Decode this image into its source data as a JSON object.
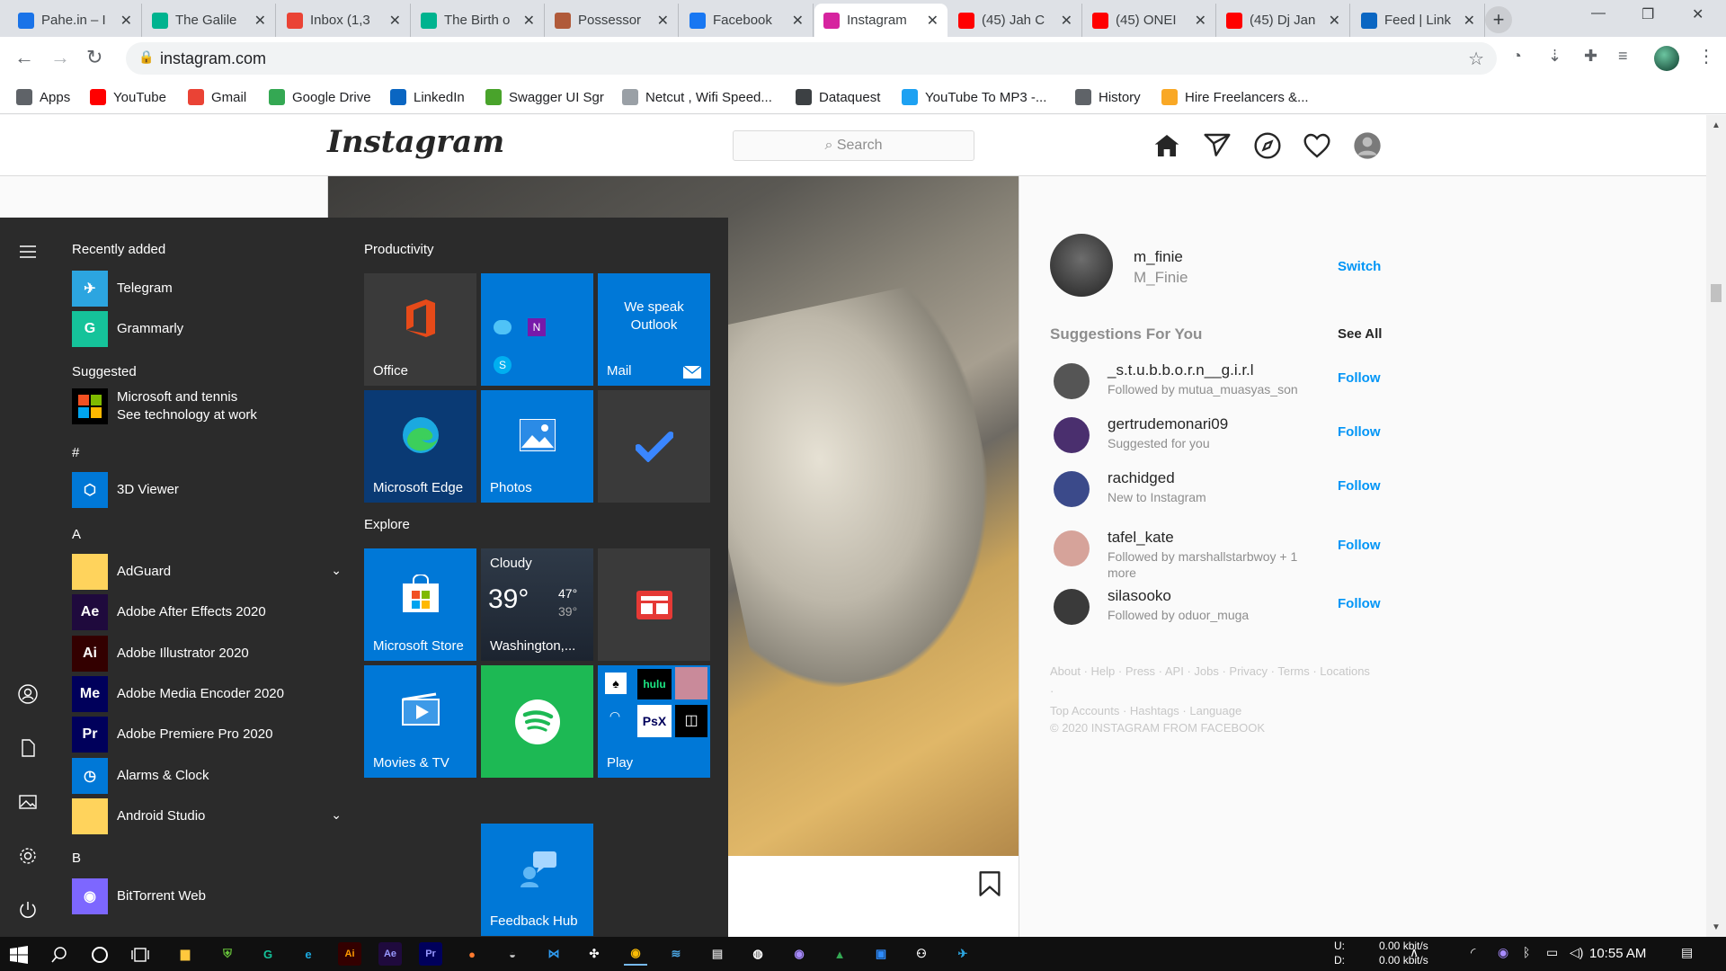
{
  "browser": {
    "tabs": [
      {
        "title": "Pahe.in – I",
        "fav": "pahe",
        "color": "#1a73e8"
      },
      {
        "title": "The Galile",
        "fav": "T",
        "color": "#00b38f"
      },
      {
        "title": "Inbox (1,3",
        "fav": "M",
        "color": "#ea4335"
      },
      {
        "title": "The Birth o",
        "fav": "T",
        "color": "#00b38f"
      },
      {
        "title": "Possessor",
        "fav": "P",
        "color": "#b05a3a"
      },
      {
        "title": "Facebook",
        "fav": "f",
        "color": "#1877f2"
      },
      {
        "title": "Instagram",
        "fav": "ig",
        "color": "#d6249f"
      },
      {
        "title": "(45) Jah C",
        "fav": "yt",
        "color": "#ff0000"
      },
      {
        "title": "(45) ONEI",
        "fav": "yt",
        "color": "#ff0000"
      },
      {
        "title": "(45) Dj Jan",
        "fav": "yt",
        "color": "#ff0000"
      },
      {
        "title": "Feed | Link",
        "fav": "in",
        "color": "#0a66c2"
      }
    ],
    "url": "instagram.com",
    "bookmarks": [
      {
        "label": "Apps",
        "icon": "apps-grid-icon",
        "color": "#5f6368"
      },
      {
        "label": "YouTube",
        "icon": "youtube-icon",
        "color": "#ff0000"
      },
      {
        "label": "Gmail",
        "icon": "gmail-icon",
        "color": "#ea4335"
      },
      {
        "label": "Google Drive",
        "icon": "drive-icon",
        "color": "#34a853"
      },
      {
        "label": "LinkedIn",
        "icon": "linkedin-icon",
        "color": "#0a66c2"
      },
      {
        "label": "Swagger UI Sgr",
        "icon": "swagger-icon",
        "color": "#49a32b"
      },
      {
        "label": "Netcut , Wifi Speed...",
        "icon": "netcut-icon",
        "color": "#9aa0a6"
      },
      {
        "label": "Dataquest",
        "icon": "dataquest-icon",
        "color": "#3c4043"
      },
      {
        "label": "YouTube To MP3 -...",
        "icon": "download-icon",
        "color": "#1da1f2"
      },
      {
        "label": "History",
        "icon": "history-icon",
        "color": "#5f6368"
      },
      {
        "label": "Hire Freelancers &...",
        "icon": "freelancer-icon",
        "color": "#f9a825"
      }
    ]
  },
  "instagram": {
    "logo": "Instagram",
    "search_placeholder": "Search",
    "me": {
      "username": "m_finie",
      "name": "M_Finie",
      "switch_label": "Switch"
    },
    "suggestions_title": "Suggestions For You",
    "see_all": "See All",
    "suggestions": [
      {
        "username": "_s.t.u.b.b.o.r.n__g.i.r.l",
        "sub": "Followed by mutua_muasyas_son",
        "action": "Follow",
        "avatar_color": "#555555"
      },
      {
        "username": "gertrudemonari09",
        "sub": "Suggested for you",
        "action": "Follow",
        "avatar_color": "#4a2f6e"
      },
      {
        "username": "rachidged",
        "sub": "New to Instagram",
        "action": "Follow",
        "avatar_color": "#3b4a8a"
      },
      {
        "username": "tafel_kate",
        "sub": "Followed by marshallstarbwoy + 1 more",
        "action": "Follow",
        "avatar_color": "#d6a39a"
      },
      {
        "username": "silasooko",
        "sub": "Followed by oduor_muga",
        "action": "Follow",
        "avatar_color": "#3a3a3a"
      }
    ],
    "footer_line1": "About · Help · Press · API · Jobs · Privacy · Terms · Locations ·",
    "footer_line2": "Top Accounts · Hashtags · Language",
    "copyright": "© 2020 INSTAGRAM FROM FACEBOOK"
  },
  "start_menu": {
    "recently_added_label": "Recently added",
    "recent": [
      {
        "name": "Telegram",
        "letter": "✈",
        "color": "#2ca5e0"
      },
      {
        "name": "Grammarly",
        "letter": "G",
        "color": "#15c39a"
      }
    ],
    "suggested_label": "Suggested",
    "suggested": {
      "line1": "Microsoft and tennis",
      "line2": "See technology at work"
    },
    "hash_label": "#",
    "viewer": {
      "name": "3D Viewer",
      "letter": "⬡",
      "color": "#0078d7"
    },
    "a_label": "A",
    "a_apps": [
      {
        "name": "AdGuard",
        "letter": "",
        "color": "#ffd35c",
        "chevron": "⌄"
      },
      {
        "name": "Adobe After Effects 2020",
        "letter": "Ae",
        "color": "#1f0a3d"
      },
      {
        "name": "Adobe Illustrator 2020",
        "letter": "Ai",
        "color": "#330000"
      },
      {
        "name": "Adobe Media Encoder 2020",
        "letter": "Me",
        "color": "#00005b"
      },
      {
        "name": "Adobe Premiere Pro 2020",
        "letter": "Pr",
        "color": "#00005b"
      },
      {
        "name": "Alarms & Clock",
        "letter": "◷",
        "color": "#0078d7"
      },
      {
        "name": "Android Studio",
        "letter": "",
        "color": "#ffd35c",
        "chevron": "⌄"
      }
    ],
    "b_label": "B",
    "b_apps": [
      {
        "name": "BitTorrent Web",
        "letter": "◉",
        "color": "#7d67ff"
      }
    ],
    "productivity_label": "Productivity",
    "explore_label": "Explore",
    "tiles": {
      "office": "Office",
      "mail_top": "We speak Outlook",
      "mail": "Mail",
      "edge": "Microsoft Edge",
      "photos": "Photos",
      "store": "Microsoft Store",
      "weather_cond": "Cloudy",
      "weather_temp": "39°",
      "weather_hi": "47°",
      "weather_lo": "39°",
      "weather_city": "Washington,...",
      "movies": "Movies & TV",
      "play": "Play",
      "feedback": "Feedback Hub"
    }
  },
  "taskbar": {
    "upload_label": "U:",
    "download_label": "D:",
    "upload_value": "0.00 kbit/s",
    "download_value": "0.00 kbit/s",
    "time": "10:55 AM"
  }
}
